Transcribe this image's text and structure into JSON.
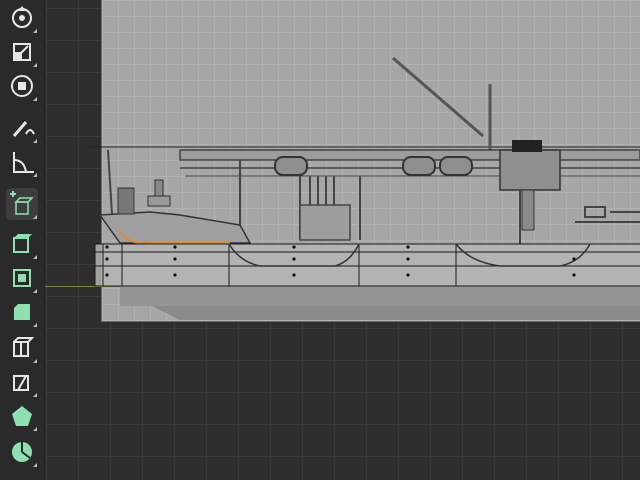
{
  "app": {
    "viewport_background": "#2e2e2e",
    "reference_image_background": "#a6a6a6",
    "selection_highlight": "#e08a30",
    "ground_line_color": "#6f8f3f"
  },
  "toolbar": {
    "tools": [
      {
        "name": "orbit-icon"
      },
      {
        "name": "scale-icon"
      },
      {
        "name": "transform-icon"
      },
      {
        "name": "annotate-icon"
      },
      {
        "name": "measure-icon"
      },
      {
        "name": "add-cube-icon"
      },
      {
        "name": "cube-face-icon"
      },
      {
        "name": "cube-inset-icon"
      },
      {
        "name": "cube-bevel-icon"
      },
      {
        "name": "loop-cut-icon"
      },
      {
        "name": "knife-icon"
      },
      {
        "name": "poly-build-icon"
      },
      {
        "name": "spin-icon"
      }
    ],
    "active_tool": "add-cube-icon"
  }
}
